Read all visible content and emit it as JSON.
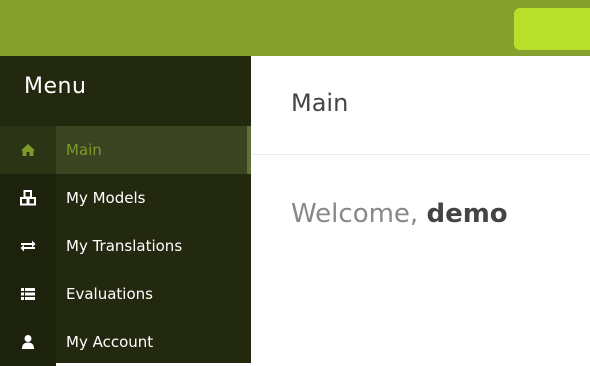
{
  "colors": {
    "topbar": "#86a02d",
    "topbar_button": "#b8e02a",
    "sidebar_bg": "#23290f",
    "active_label": "#7e9a2a"
  },
  "sidebar": {
    "title": "Menu",
    "items": [
      {
        "label": "Main",
        "icon": "home-icon",
        "active": true
      },
      {
        "label": "My Models",
        "icon": "cubes-icon",
        "active": false
      },
      {
        "label": "My Translations",
        "icon": "exchange-icon",
        "active": false
      },
      {
        "label": "Evaluations",
        "icon": "list-icon",
        "active": false
      },
      {
        "label": "My Account",
        "icon": "user-icon",
        "active": false
      }
    ]
  },
  "main": {
    "title": "Main",
    "welcome_prefix": "Welcome, ",
    "username": "demo"
  }
}
